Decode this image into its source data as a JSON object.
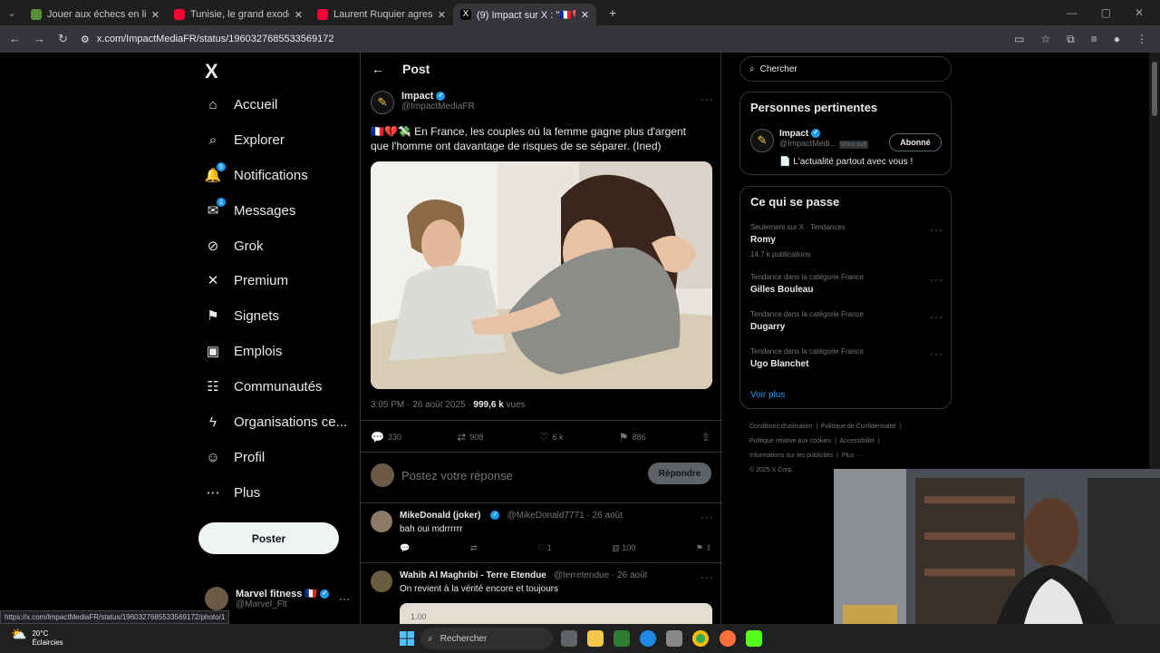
{
  "browser": {
    "tabs": [
      {
        "title": "Jouer aux échecs en ligne conti",
        "color": "#5a8f3a"
      },
      {
        "title": "Tunisie, le grand exode des mé",
        "color": "#ff0033"
      },
      {
        "title": "Laurent Ruquier agresse un",
        "color": "#ff0033"
      },
      {
        "title": "(9) Impact sur X : \"🇫🇷💔💸 En F",
        "color": "#000000"
      }
    ],
    "url": "x.com/ImpactMediaFR/status/1960327685533569172",
    "status_url": "https://x.com/ImpactMediaFR/status/1960327685533569172/photo/1"
  },
  "sidebar": {
    "logo": "X",
    "items": [
      {
        "label": "Accueil",
        "icon": "⌂"
      },
      {
        "label": "Explorer",
        "icon": "⌕"
      },
      {
        "label": "Notifications",
        "icon": "🔔",
        "badge": "5"
      },
      {
        "label": "Messages",
        "icon": "✉",
        "badge": "1"
      },
      {
        "label": "Grok",
        "icon": "⊘"
      },
      {
        "label": "Premium",
        "icon": "✕"
      },
      {
        "label": "Signets",
        "icon": "⚑"
      },
      {
        "label": "Emplois",
        "icon": "▣"
      },
      {
        "label": "Communautés",
        "icon": "☷"
      },
      {
        "label": "Organisations ce...",
        "icon": "ϟ"
      },
      {
        "label": "Profil",
        "icon": "☺"
      },
      {
        "label": "Plus",
        "icon": "⋯"
      }
    ],
    "post_button": "Poster",
    "account": {
      "name": "Marvel fitness 🇫🇷",
      "handle": "@Marvel_Flt"
    }
  },
  "main": {
    "header": "Post",
    "tweet": {
      "name": "Impact",
      "handle": "@ImpactMediaFR",
      "text": "🇫🇷💔💸 En France, les couples où la femme gagne plus d'argent que l'homme ont davantage de risques de se séparer. (Ined)",
      "time": "3:05 PM · 26 août 2025 · ",
      "views": "999,6 k",
      "views_label": " vues",
      "replies": "330",
      "reposts": "908",
      "likes": "6 k",
      "bookmarks": "886"
    },
    "reply_placeholder": "Postez votre réponse",
    "reply_button": "Répondre",
    "comments": [
      {
        "name": "MikeDonald (joker)",
        "handle": "@MikeDonald7771 · 26 août",
        "text": "bah oui mdrrrrrr",
        "likes": "1",
        "views": "100"
      },
      {
        "name": "Wahib Al Maghribi - Terre Etendue",
        "handle": "@terretendue · 26 août",
        "text": "On revient à la vérité encore et toujours",
        "media_label": "1.00"
      }
    ]
  },
  "right": {
    "search_placeholder": "Chercher",
    "relevant": {
      "title": "Personnes pertinentes",
      "name": "Impact",
      "handle": "@ImpactMedi...",
      "follows_you": "Vous suit",
      "follow_button": "Abonné",
      "bio": "📄 L'actualité partout avec vous !"
    },
    "trends_title": "Ce qui se passe",
    "trends": [
      {
        "context": "Seulement sur X · Tendances",
        "topic": "Romy",
        "posts": "14,7 k publications"
      },
      {
        "context": "Tendance dans la catégorie France",
        "topic": "Gilles Bouleau",
        "posts": ""
      },
      {
        "context": "Tendance dans la catégorie France",
        "topic": "Dugarry",
        "posts": ""
      },
      {
        "context": "Tendance dans la catégorie France",
        "topic": "Ugo Blanchet",
        "posts": ""
      }
    ],
    "show_more": "Voir plus",
    "footer": {
      "l1": "Conditions d'utilisation",
      "l2": "Politique de Confidentialité",
      "l3": "Politique relative aux cookies",
      "l4": "Accessibilité",
      "l5": "Informations sur les publicités",
      "l6": "Plus ···",
      "l7": "© 2025 X Corp."
    }
  },
  "taskbar": {
    "temp": "20°C",
    "weather": "Éclaircies",
    "search": "Rechercher"
  }
}
